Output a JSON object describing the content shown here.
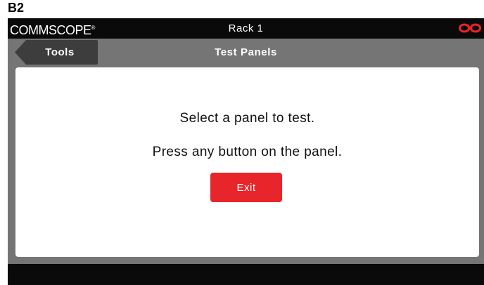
{
  "figure_label": "B2",
  "header": {
    "logo_text": "COMMSCOPE",
    "logo_reg": "®",
    "title": "Rack 1",
    "status_icon": "link-broken-icon",
    "status_icon_color": "#e8252a"
  },
  "nav": {
    "back_label": "Tools",
    "title": "Test Panels"
  },
  "main": {
    "line1": "Select a panel to test.",
    "line2": "Press any button on the panel.",
    "exit_label": "Exit"
  },
  "colors": {
    "accent": "#e8252a",
    "bar": "#0a0a0a",
    "background": "#757575"
  }
}
